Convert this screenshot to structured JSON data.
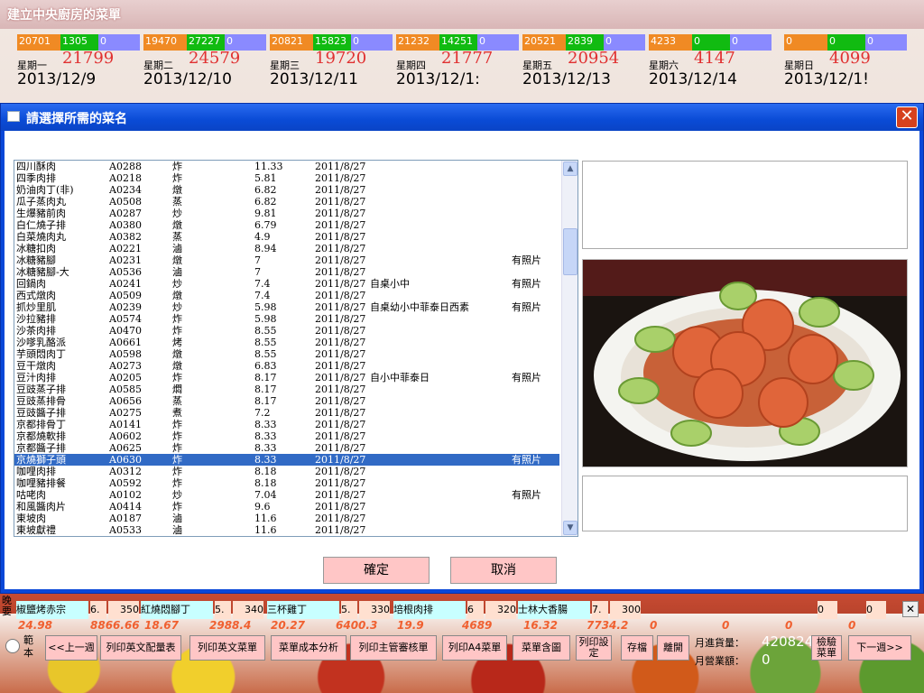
{
  "app": {
    "title": "建立中央廚房的菜單"
  },
  "week": [
    {
      "bars": [
        "20701",
        "1305",
        "0"
      ],
      "weekday": "星期一",
      "count": "21799",
      "date": "2013/12/9"
    },
    {
      "bars": [
        "19470",
        "27227",
        "0"
      ],
      "weekday": "星期二",
      "count": "24579",
      "date": "2013/12/10"
    },
    {
      "bars": [
        "20821",
        "15823",
        "0"
      ],
      "weekday": "星期三",
      "count": "19720",
      "date": "2013/12/11"
    },
    {
      "bars": [
        "21232",
        "14251",
        "0"
      ],
      "weekday": "星期四",
      "count": "21777",
      "date": "2013/12/1:"
    },
    {
      "bars": [
        "20521",
        "2839",
        "0"
      ],
      "weekday": "星期五",
      "count": "20954",
      "date": "2013/12/13"
    },
    {
      "bars": [
        "4233",
        "0",
        "0"
      ],
      "weekday": "星期六",
      "count": "4147",
      "date": "2013/12/14"
    },
    {
      "bars": [
        "0",
        "0",
        "0"
      ],
      "weekday": "星期日",
      "count": "4099",
      "date": "2013/12/1!"
    }
  ],
  "dialog": {
    "title": "請選擇所需的菜名",
    "close_label": "✕",
    "ok_label": "確定",
    "cancel_label": "取消"
  },
  "dishes": [
    [
      "四川酥肉",
      "A0288",
      "炸",
      "11.33",
      "2011/8/27",
      "",
      ""
    ],
    [
      "四季肉排",
      "A0218",
      "炸",
      "5.81",
      "2011/8/27",
      "",
      ""
    ],
    [
      "奶油肉丁(非)",
      "A0234",
      "燉",
      "6.82",
      "2011/8/27",
      "",
      ""
    ],
    [
      "瓜子蒸肉丸",
      "A0508",
      "蒸",
      "6.82",
      "2011/8/27",
      "",
      ""
    ],
    [
      "生爆豬前肉",
      "A0287",
      "炒",
      "9.81",
      "2011/8/27",
      "",
      ""
    ],
    [
      "白仁燒子排",
      "A0380",
      "燉",
      "6.79",
      "2011/8/27",
      "",
      ""
    ],
    [
      "白菜燒肉丸",
      "A0382",
      "蒸",
      "4.9",
      "2011/8/27",
      "",
      ""
    ],
    [
      "冰糖扣肉",
      "A0221",
      "滷",
      "8.94",
      "2011/8/27",
      "",
      ""
    ],
    [
      "冰糖豬腳",
      "A0231",
      "燉",
      "7",
      "2011/8/27",
      "",
      "有照片"
    ],
    [
      "冰糖豬腳-大",
      "A0536",
      "滷",
      "7",
      "2011/8/27",
      "",
      ""
    ],
    [
      "回鍋肉",
      "A0241",
      "炒",
      "7.4",
      "2011/8/27",
      "自桌小中",
      "有照片"
    ],
    [
      "西式燉肉",
      "A0509",
      "燉",
      "7.4",
      "2011/8/27",
      "",
      ""
    ],
    [
      "抓炒里肌",
      "A0239",
      "炒",
      "5.98",
      "2011/8/27",
      "自桌幼小中菲泰日西素",
      "有照片"
    ],
    [
      "沙拉豬排",
      "A0574",
      "炸",
      "5.98",
      "2011/8/27",
      "",
      ""
    ],
    [
      "沙茶肉排",
      "A0470",
      "炸",
      "8.55",
      "2011/8/27",
      "",
      ""
    ],
    [
      "沙嗲乳酪派",
      "A0661",
      "烤",
      "8.55",
      "2011/8/27",
      "",
      ""
    ],
    [
      "芋頭悶肉丁",
      "A0598",
      "燉",
      "8.55",
      "2011/8/27",
      "",
      ""
    ],
    [
      "豆干燉肉",
      "A0273",
      "燉",
      "6.83",
      "2011/8/27",
      "",
      ""
    ],
    [
      "豆汁肉排",
      "A0205",
      "炸",
      "8.17",
      "2011/8/27",
      "自小中菲泰日",
      "有照片"
    ],
    [
      "豆豉蒸子排",
      "A0585",
      "燜",
      "8.17",
      "2011/8/27",
      "",
      ""
    ],
    [
      "豆豉蒸排骨",
      "A0656",
      "蒸",
      "8.17",
      "2011/8/27",
      "",
      ""
    ],
    [
      "豆豉醬子排",
      "A0275",
      "煮",
      "7.2",
      "2011/8/27",
      "",
      ""
    ],
    [
      "京都排骨丁",
      "A0141",
      "炸",
      "8.33",
      "2011/8/27",
      "",
      ""
    ],
    [
      "京都燒軟排",
      "A0602",
      "炸",
      "8.33",
      "2011/8/27",
      "",
      ""
    ],
    [
      "京都醬子排",
      "A0625",
      "炸",
      "8.33",
      "2011/8/27",
      "",
      ""
    ],
    [
      "京燒獅子頭",
      "A0630",
      "炸",
      "8.33",
      "2011/8/27",
      "",
      "有照片"
    ],
    [
      "咖哩肉排",
      "A0312",
      "炸",
      "8.18",
      "2011/8/27",
      "",
      ""
    ],
    [
      "咖哩豬排餐",
      "A0592",
      "炸",
      "8.18",
      "2011/8/27",
      "",
      ""
    ],
    [
      "咕咾肉",
      "A0102",
      "炒",
      "7.04",
      "2011/8/27",
      "",
      "有照片"
    ],
    [
      "和風醬肉片",
      "A0414",
      "炸",
      "9.6",
      "2011/8/27",
      "",
      ""
    ],
    [
      "東坡肉",
      "A0187",
      "滷",
      "11.6",
      "2011/8/27",
      "",
      ""
    ],
    [
      "東坡獻禮",
      "A0533",
      "滷",
      "11.6",
      "2011/8/27",
      "",
      ""
    ]
  ],
  "selected_index": 25,
  "bottom_meals": {
    "row_label": "晚要",
    "items": [
      {
        "name": "椒鹽烤赤宗",
        "qty": "6.",
        "n": "350"
      },
      {
        "name": "紅燒悶腳丁",
        "qty": "5.",
        "n": "340"
      },
      {
        "name": "三杯雞丁",
        "qty": "5.",
        "n": "330"
      },
      {
        "name": "培根肉排",
        "qty": "6",
        "n": "320"
      },
      {
        "name": "士林大香腸",
        "qty": "7.",
        "n": "300"
      }
    ],
    "zeros": [
      "0",
      "0"
    ]
  },
  "stats": [
    "24.98",
    "8866.66",
    "18.67",
    "2988.4",
    "20.27",
    "6400.3",
    "19.9",
    "4689",
    "16.32",
    "7734.2",
    "0",
    "0",
    "0",
    "0"
  ],
  "buttons": {
    "sample": "範本",
    "prev_week": "<<上一週",
    "print_en_table": "列印英文配量表",
    "print_en_menu": "列印英文菜單",
    "cost_analysis": "菜單成本分析",
    "print_review": "列印主管審核單",
    "print_a4": "列印A4菜單",
    "menu_with": "菜單含圖",
    "print_setup": "列印設定",
    "save": "存檔",
    "leave": "離開",
    "check_menu": "檢驗菜單",
    "next_week": "下一週>>"
  },
  "summary": {
    "monthly_purchase_label": "月進貨量：",
    "monthly_purchase": "420824",
    "monthly_revenue_label": "月營業額：",
    "monthly_revenue": "0"
  },
  "colors": {
    "orange": "#f08a24",
    "green": "#11bb11",
    "blue": "#8a8aff",
    "title_blue": "#0a4bd6",
    "button_pink": "#ffc6c6",
    "selection": "#316ac5"
  }
}
